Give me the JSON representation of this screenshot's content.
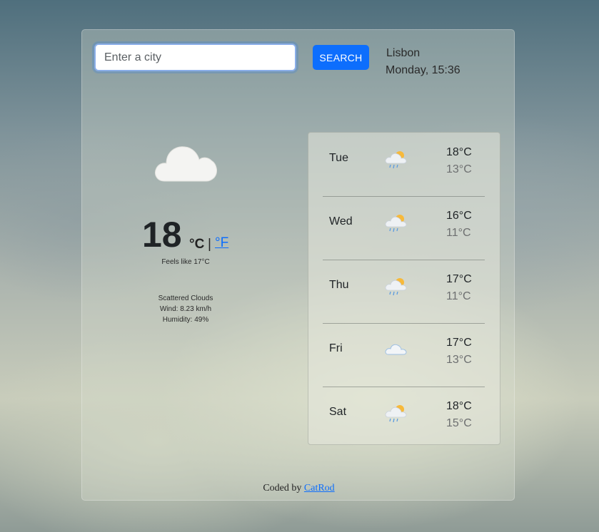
{
  "search": {
    "placeholder": "Enter a city",
    "value": "",
    "button_label": "SEARCH"
  },
  "location": {
    "city": "Lisbon",
    "datetime": "Monday, 15:36"
  },
  "current": {
    "icon": "cloud-icon",
    "temperature": "18",
    "unit_celsius": "°C",
    "unit_separator": "|",
    "unit_fahrenheit": "°F",
    "feels_like": "Feels like 17°C",
    "description": "Scattered Clouds",
    "wind": "Wind: 8.23 km/h",
    "humidity": "Humidity: 49%"
  },
  "forecast": [
    {
      "day": "Tue",
      "icon": "sun-cloud-rain-icon",
      "max": "18°C",
      "min": "13°C"
    },
    {
      "day": "Wed",
      "icon": "sun-cloud-rain-icon",
      "max": "16°C",
      "min": "11°C"
    },
    {
      "day": "Thu",
      "icon": "sun-cloud-rain-icon",
      "max": "17°C",
      "min": "11°C"
    },
    {
      "day": "Fri",
      "icon": "cloud-icon",
      "max": "17°C",
      "min": "13°C"
    },
    {
      "day": "Sat",
      "icon": "sun-cloud-rain-icon",
      "max": "18°C",
      "min": "15°C"
    }
  ],
  "footer": {
    "prefix": "Coded by",
    "link_label": "CatRod"
  },
  "colors": {
    "accent": "#0d6efd"
  }
}
